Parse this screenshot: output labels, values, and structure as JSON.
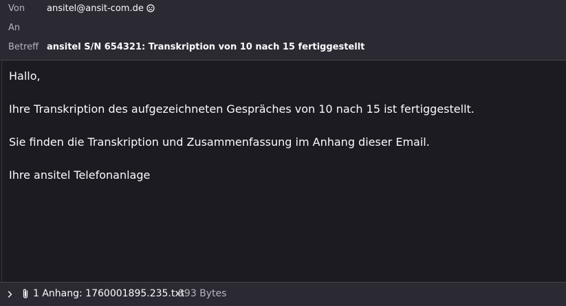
{
  "header": {
    "from_label": "Von",
    "from_value": "ansitel@ansit-com.de",
    "to_label": "An",
    "subject_label": "Betreff",
    "subject_value": "ansitel S/N 654321: Transkription von 10 nach 15 fertiggestellt",
    "contact_icon": "contact-face-icon"
  },
  "message": {
    "greeting": "Hallo,",
    "line1": "Ihre Transkription des aufgezeichneten Gespräches von 10 nach 15 ist fertiggestellt.",
    "line2": "Sie finden die Transkription und Zusammenfassung im Anhang dieser Email.",
    "signature": "Ihre ansitel Telefonanlage"
  },
  "attachments": {
    "summary": "1 Anhang: 1760001895.235.txt",
    "size": "893 Bytes",
    "toggle_icon": "chevron-right-icon",
    "attachment_icon": "paperclip-icon"
  },
  "colors": {
    "header_bg": "#2b2a33",
    "body_bg": "#1c1b22",
    "text": "#fbfbfe",
    "muted": "#b6b5bd"
  }
}
